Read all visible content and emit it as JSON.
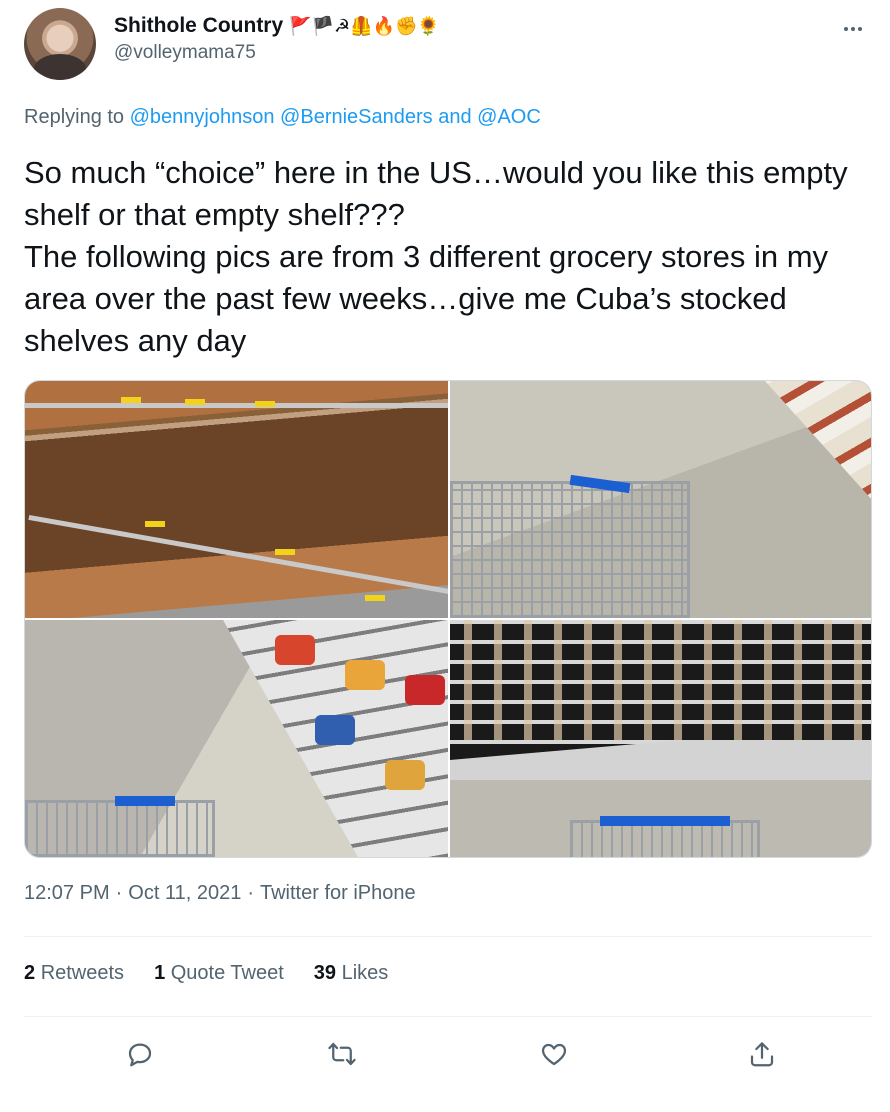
{
  "author": {
    "display_name": "Shithole Country",
    "emoji_badges": "🚩🏴☭🦺🔥✊🌻",
    "handle": "@volleymama75"
  },
  "reply": {
    "prefix": "Replying to",
    "mention_1": "@bennyjohnson",
    "mention_2": "@BernieSanders",
    "joiner": "and",
    "mention_3": "@AOC"
  },
  "tweet": {
    "text": "So much “choice” here in the US…would you like this empty shelf or that empty shelf???\nThe following pics are from 3 different grocery stores in my area over the past few weeks…give me Cuba’s stocked shelves any day"
  },
  "media": {
    "photos": [
      "empty-wooden-shelf",
      "aisle-with-cart",
      "chip-aisle-with-cart",
      "fridge-section-with-cart"
    ]
  },
  "meta": {
    "time": "12:07 PM",
    "separator": "·",
    "date": "Oct 11, 2021",
    "source": "Twitter for iPhone"
  },
  "stats": {
    "retweets_count": "2",
    "retweets_label": "Retweets",
    "quotes_count": "1",
    "quotes_label": "Quote Tweet",
    "likes_count": "39",
    "likes_label": "Likes"
  },
  "actions": [
    "reply-icon",
    "retweet-icon",
    "like-icon",
    "share-icon"
  ],
  "colors": {
    "link": "#1d9bf0",
    "secondary_text": "#536471",
    "primary_text": "#0f1419"
  }
}
